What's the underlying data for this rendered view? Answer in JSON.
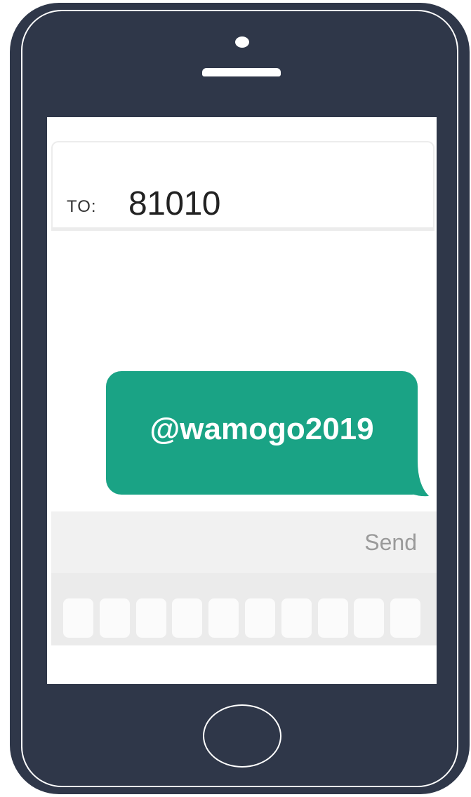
{
  "colors": {
    "phone": "#2f3749",
    "bubble": "#1aa385"
  },
  "message": {
    "to_label": "TO:",
    "recipient": "81010",
    "text": "@wamogo2019"
  },
  "composer": {
    "send_label": "Send"
  },
  "keyboard": {
    "key_count": 10
  },
  "icons": {
    "camera": "camera-icon",
    "speaker": "speaker-icon",
    "home": "home-button-icon"
  }
}
